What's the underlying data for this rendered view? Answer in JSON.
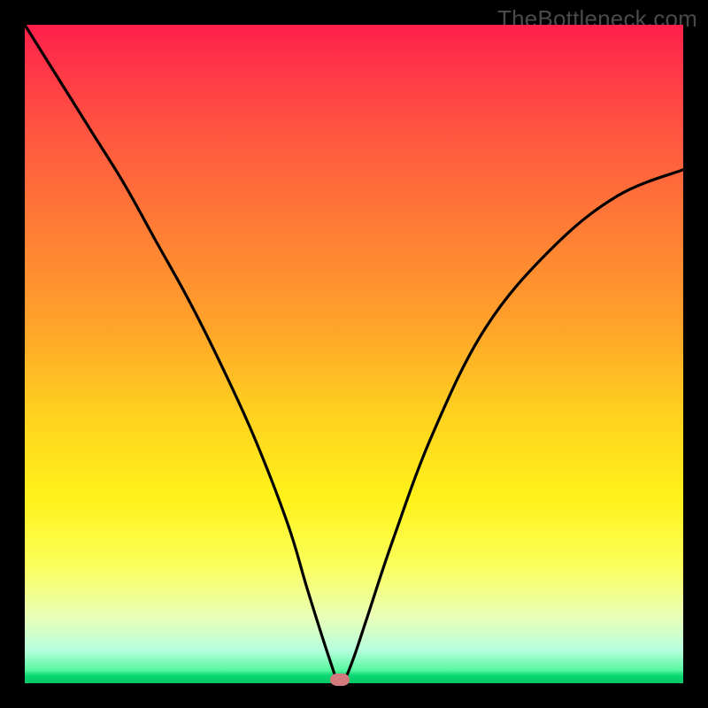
{
  "watermark": "TheBottleneck.com",
  "colors": {
    "frame": "#000000",
    "curve": "#000000",
    "marker": "#d47a7f",
    "gradient_top": "#ff1f4b",
    "gradient_bottom": "#0bd873"
  },
  "chart_data": {
    "type": "line",
    "title": "",
    "xlabel": "",
    "ylabel": "",
    "xlim": [
      0,
      100
    ],
    "ylim": [
      0,
      100
    ],
    "grid": false,
    "series": [
      {
        "name": "curve",
        "x": [
          0,
          5,
          10,
          15,
          20,
          25,
          30,
          35,
          40,
          43,
          46.5,
          47.5,
          48.5,
          50,
          52,
          56,
          62,
          70,
          80,
          90,
          100
        ],
        "y": [
          100,
          92,
          84,
          76,
          67,
          58,
          48,
          37,
          24,
          14,
          3,
          0.5,
          0.5,
          4,
          10,
          22,
          38,
          54,
          66,
          74,
          78
        ]
      }
    ],
    "marker": {
      "x": 47.8,
      "y": 0.5
    },
    "background": "vertical-gradient red→green"
  }
}
